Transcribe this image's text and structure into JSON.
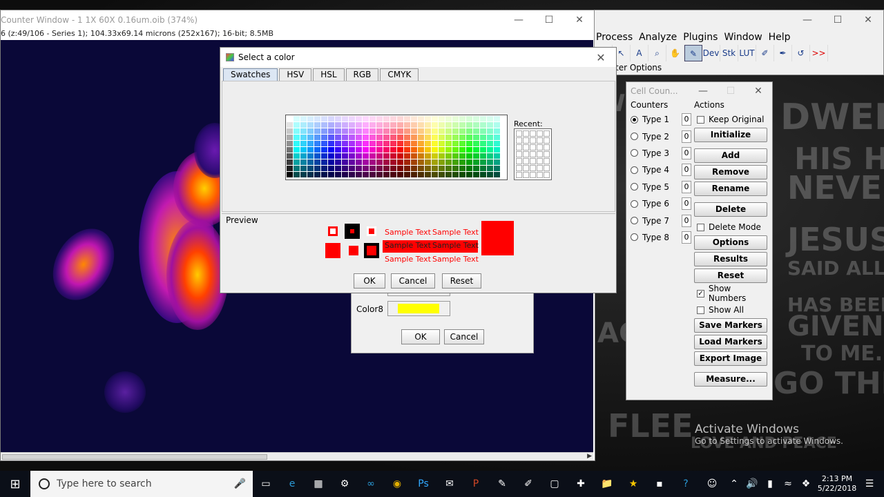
{
  "image_window": {
    "title": "Counter Window - 1 1X 60X 0.16um.oib (374%)",
    "info": "6 (z:49/106 - Series 1); 104.33x69.14 microns (252x167); 16-bit; 8.5MB"
  },
  "imagej": {
    "menus": [
      "Process",
      "Analyze",
      "Plugins",
      "Window",
      "Help"
    ],
    "tools": [
      "+",
      "↖",
      "A",
      "⌕",
      "✋",
      "✎",
      "Dev",
      "Stk",
      "LUT",
      "✐",
      "✒",
      "↺",
      ">>"
    ],
    "status": "ter Options"
  },
  "cell_counter": {
    "title": "Cell Coun...",
    "counters_label": "Counters",
    "actions_label": "Actions",
    "types": [
      {
        "label": "Type 1",
        "count": "0"
      },
      {
        "label": "Type 2",
        "count": "0"
      },
      {
        "label": "Type 3",
        "count": "0"
      },
      {
        "label": "Type 4",
        "count": "0"
      },
      {
        "label": "Type 5",
        "count": "0"
      },
      {
        "label": "Type 6",
        "count": "0"
      },
      {
        "label": "Type 7",
        "count": "0"
      },
      {
        "label": "Type 8",
        "count": "0"
      }
    ],
    "keep_original": "Keep Original",
    "initialize": "Initialize",
    "add": "Add",
    "remove": "Remove",
    "rename": "Rename",
    "delete": "Delete",
    "delete_mode": "Delete Mode",
    "options": "Options",
    "results": "Results",
    "reset": "Reset",
    "show_numbers": "Show Numbers",
    "show_all": "Show All",
    "save_markers": "Save Markers",
    "load_markers": "Load Markers",
    "export_image": "Export Image",
    "measure": "Measure..."
  },
  "colors_dialog": {
    "label": "Color8",
    "swatch_color": "#ffff00",
    "ok": "OK",
    "cancel": "Cancel"
  },
  "select_color": {
    "title": "Select a color",
    "tabs": [
      "Swatches",
      "HSV",
      "HSL",
      "RGB",
      "CMYK"
    ],
    "recent_label": "Recent:",
    "preview_label": "Preview",
    "sample_text": "Sample Text",
    "selected_color": "#ff0000",
    "ok": "OK",
    "cancel": "Cancel",
    "reset": "Reset"
  },
  "desktop": {
    "watermark_title": "Activate Windows",
    "watermark_sub": "Go to Settings to activate Windows."
  },
  "taskbar": {
    "search_placeholder": "Type here to search",
    "time": "2:13 PM",
    "date": "5/22/2018"
  }
}
